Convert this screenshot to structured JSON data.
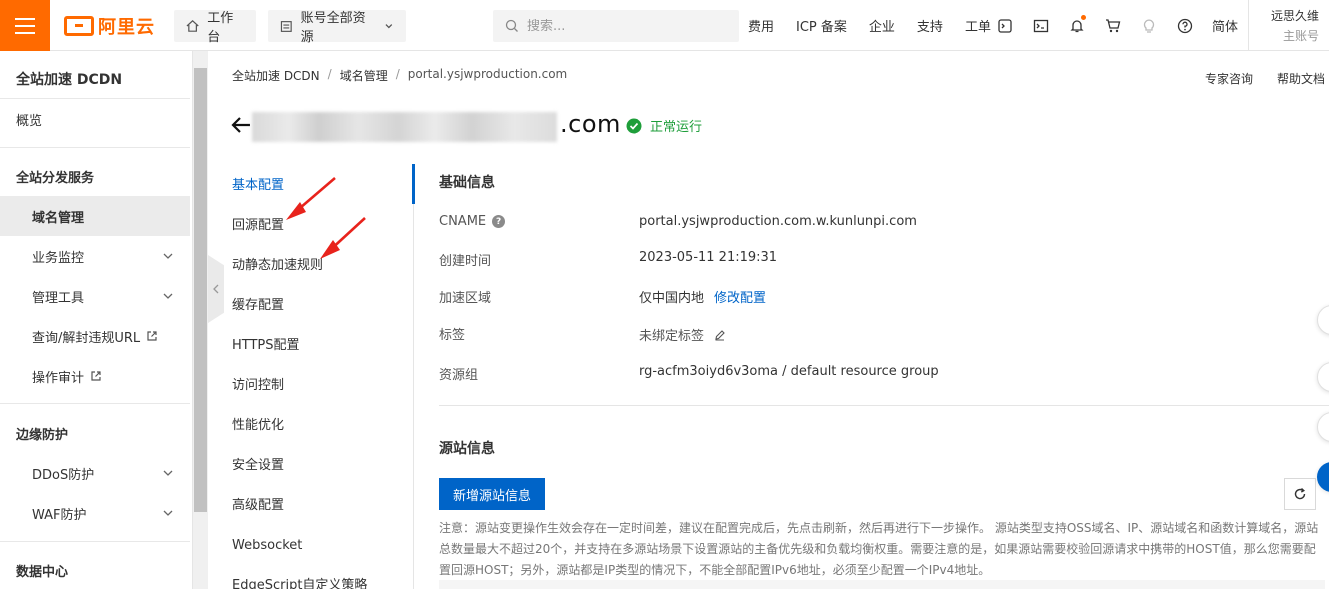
{
  "topbar": {
    "logo_text": "阿里云",
    "workbench_label": "工作台",
    "resources_label": "账号全部资源",
    "search_placeholder": "搜索...",
    "links": [
      "费用",
      "ICP 备案",
      "企业",
      "支持",
      "工单"
    ],
    "lang": "简体",
    "user_name": "远思久维",
    "user_sub": "主账号",
    "accent": "#ff6a00"
  },
  "sidebar": {
    "title": "全站加速 DCDN",
    "overview": "概览",
    "group_distribution": "全站分发服务",
    "domain_mgmt": "域名管理",
    "biz_monitor": "业务监控",
    "mgmt_tools": "管理工具",
    "query_url": "查询/解封违规URL",
    "audit": "操作审计",
    "group_edge": "边缘防护",
    "ddos": "DDoS防护",
    "waf": "WAF防护",
    "group_data": "数据中心"
  },
  "breadcrumb": {
    "root": "全站加速 DCDN",
    "sep": "/",
    "domain_mgmt": "域名管理",
    "current": "portal.ysjwproduction.com"
  },
  "top_links": {
    "expert": "专家咨询",
    "help": "帮助文档"
  },
  "page": {
    "title_suffix": ".com",
    "status": "正常运行",
    "status_color": "#1e9e3a"
  },
  "subnav": {
    "items": [
      "基本配置",
      "回源配置",
      "动静态加速规则",
      "缓存配置",
      "HTTPS配置",
      "访问控制",
      "性能优化",
      "安全设置",
      "高级配置",
      "Websocket",
      "EdgeScript自定义策略"
    ],
    "active_color": "#0064c8"
  },
  "basic_info": {
    "title": "基础信息",
    "cname_label": "CNAME",
    "cname_value": "portal.ysjwproduction.com.w.kunlunpi.com",
    "created_label": "创建时间",
    "created_value": "2023-05-11 21:19:31",
    "region_label": "加速区域",
    "region_value": "仅中国内地",
    "region_edit": "修改配置",
    "tag_label": "标签",
    "tag_value": "未绑定标签",
    "rg_label": "资源组",
    "rg_value": "rg-acfm3oiyd6v3oma / default resource group"
  },
  "origin_info": {
    "title": "源站信息",
    "add_button": "新增源站信息",
    "note": "注意：源站变更操作生效会存在一定时间差，建议在配置完成后，先点击刷新，然后再进行下一步操作。 源站类型支持OSS域名、IP、源站域名和函数计算域名，源站总数量最大不超过20个，并支持在多源站场景下设置源站的主备优先级和负载均衡权重。需要注意的是，如果源站需要校验回源请求中携带的HOST值，那么您需要配置回源HOST；另外，源站都是IP类型的情况下，不能全部配置IPv6地址，必须至少配置一个IPv4地址。"
  }
}
